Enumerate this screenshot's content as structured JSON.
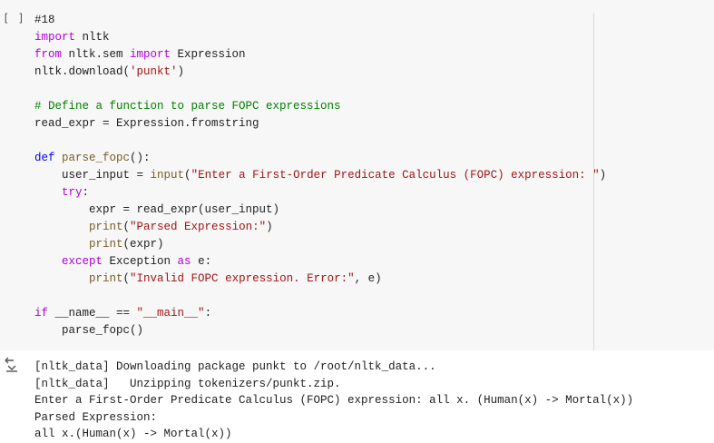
{
  "cell": {
    "run_indicator": "[ ]",
    "lines": [
      [
        {
          "t": "#18",
          "c": "plain"
        }
      ],
      [
        {
          "t": "import",
          "c": "kw2"
        },
        {
          "t": " nltk",
          "c": "plain"
        }
      ],
      [
        {
          "t": "from",
          "c": "kw2"
        },
        {
          "t": " nltk.sem ",
          "c": "plain"
        },
        {
          "t": "import",
          "c": "kw2"
        },
        {
          "t": " Expression",
          "c": "plain"
        }
      ],
      [
        {
          "t": "nltk.download(",
          "c": "plain"
        },
        {
          "t": "'punkt'",
          "c": "str"
        },
        {
          "t": ")",
          "c": "plain"
        }
      ],
      [
        {
          "t": "",
          "c": "plain"
        }
      ],
      [
        {
          "t": "# Define a function to parse FOPC expressions",
          "c": "cm"
        }
      ],
      [
        {
          "t": "read_expr = Expression.fromstring",
          "c": "plain"
        }
      ],
      [
        {
          "t": "",
          "c": "plain"
        }
      ],
      [
        {
          "t": "def",
          "c": "kw"
        },
        {
          "t": " ",
          "c": "plain"
        },
        {
          "t": "parse_fopc",
          "c": "fn"
        },
        {
          "t": "():",
          "c": "plain"
        }
      ],
      [
        {
          "t": "    user_input = ",
          "c": "plain"
        },
        {
          "t": "input",
          "c": "fn"
        },
        {
          "t": "(",
          "c": "plain"
        },
        {
          "t": "\"Enter a First-Order Predicate Calculus (FOPC) expression: \"",
          "c": "str"
        },
        {
          "t": ")",
          "c": "plain"
        }
      ],
      [
        {
          "t": "    ",
          "c": "plain"
        },
        {
          "t": "try",
          "c": "kw2"
        },
        {
          "t": ":",
          "c": "plain"
        }
      ],
      [
        {
          "t": "        expr = read_expr(user_input)",
          "c": "plain"
        }
      ],
      [
        {
          "t": "        ",
          "c": "plain"
        },
        {
          "t": "print",
          "c": "fn"
        },
        {
          "t": "(",
          "c": "plain"
        },
        {
          "t": "\"Parsed Expression:\"",
          "c": "str"
        },
        {
          "t": ")",
          "c": "plain"
        }
      ],
      [
        {
          "t": "        ",
          "c": "plain"
        },
        {
          "t": "print",
          "c": "fn"
        },
        {
          "t": "(expr)",
          "c": "plain"
        }
      ],
      [
        {
          "t": "    ",
          "c": "plain"
        },
        {
          "t": "except",
          "c": "kw2"
        },
        {
          "t": " Exception ",
          "c": "plain"
        },
        {
          "t": "as",
          "c": "kw2"
        },
        {
          "t": " e:",
          "c": "plain"
        }
      ],
      [
        {
          "t": "        ",
          "c": "plain"
        },
        {
          "t": "print",
          "c": "fn"
        },
        {
          "t": "(",
          "c": "plain"
        },
        {
          "t": "\"Invalid FOPC expression. Error:\"",
          "c": "str"
        },
        {
          "t": ", e)",
          "c": "plain"
        }
      ],
      [
        {
          "t": "",
          "c": "plain"
        }
      ],
      [
        {
          "t": "if",
          "c": "kw2"
        },
        {
          "t": " __name__ == ",
          "c": "plain"
        },
        {
          "t": "\"__main__\"",
          "c": "str"
        },
        {
          "t": ":",
          "c": "plain"
        }
      ],
      [
        {
          "t": "    parse_fopc()",
          "c": "plain"
        }
      ]
    ]
  },
  "output": {
    "icon": "output-expand-icon",
    "lines": [
      "[nltk_data] Downloading package punkt to /root/nltk_data...",
      "[nltk_data]   Unzipping tokenizers/punkt.zip.",
      "Enter a First-Order Predicate Calculus (FOPC) expression: all x. (Human(x) -> Mortal(x))",
      "Parsed Expression:",
      "all x.(Human(x) -> Mortal(x))"
    ]
  }
}
